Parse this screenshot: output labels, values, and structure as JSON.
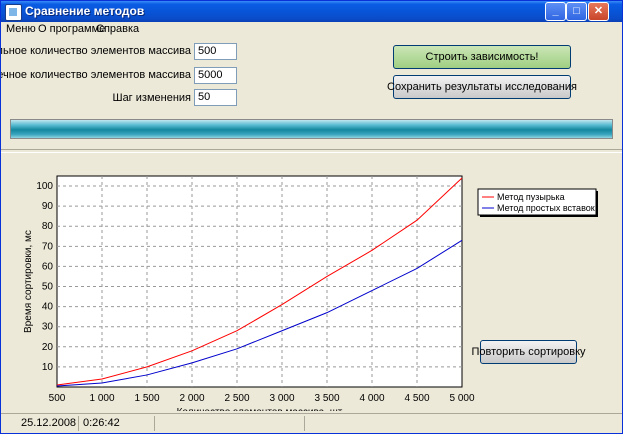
{
  "window": {
    "title": "Сравнение методов"
  },
  "menu": [
    "Меню",
    "О программе",
    "Справка"
  ],
  "form": {
    "start_label": "Начальное количество элементов массива",
    "start_value": "500",
    "end_label": "Конечное количество элементов массива",
    "end_value": "5000",
    "step_label": "Шаг изменения",
    "step_value": "50"
  },
  "buttons": {
    "build": "Строить зависимость!",
    "save": "Сохранить результаты исследования",
    "repeat": "Повторить сортировку"
  },
  "progress": {
    "fraction": 1.0
  },
  "status": {
    "date": "25.12.2008",
    "time": "0:26:42"
  },
  "colors": {
    "bubble": "#FF0000",
    "insertion": "#0000CC",
    "progress": "#1E96AF"
  },
  "chart_data": {
    "type": "line",
    "title": "",
    "xlabel": "Количество элементов массива, шт",
    "ylabel": "Время сортировки, мс",
    "xlim": [
      500,
      5000
    ],
    "ylim": [
      0,
      105
    ],
    "xticks": [
      500,
      1000,
      1500,
      2000,
      2500,
      3000,
      3500,
      4000,
      4500,
      5000
    ],
    "xtick_labels": [
      "500",
      "1 000",
      "1 500",
      "2 000",
      "2 500",
      "3 000",
      "3 500",
      "4 000",
      "4 500",
      "5 000"
    ],
    "yticks": [
      10,
      20,
      30,
      40,
      50,
      60,
      70,
      80,
      90,
      100
    ],
    "ytick_labels": [
      "10",
      "20",
      "30",
      "40",
      "50",
      "60",
      "70",
      "80",
      "90",
      "100"
    ],
    "grid": true,
    "legend_position": "top-right",
    "x": [
      500,
      1000,
      1500,
      2000,
      2500,
      3000,
      3500,
      4000,
      4500,
      5000
    ],
    "series": [
      {
        "name": "Метод пузырька",
        "values": [
          1,
          4,
          10,
          18,
          28,
          41,
          55,
          68,
          83,
          104
        ]
      },
      {
        "name": "Метод простых вставок",
        "values": [
          0.5,
          2,
          6,
          12,
          19,
          28,
          37,
          48,
          59,
          73
        ]
      }
    ]
  }
}
